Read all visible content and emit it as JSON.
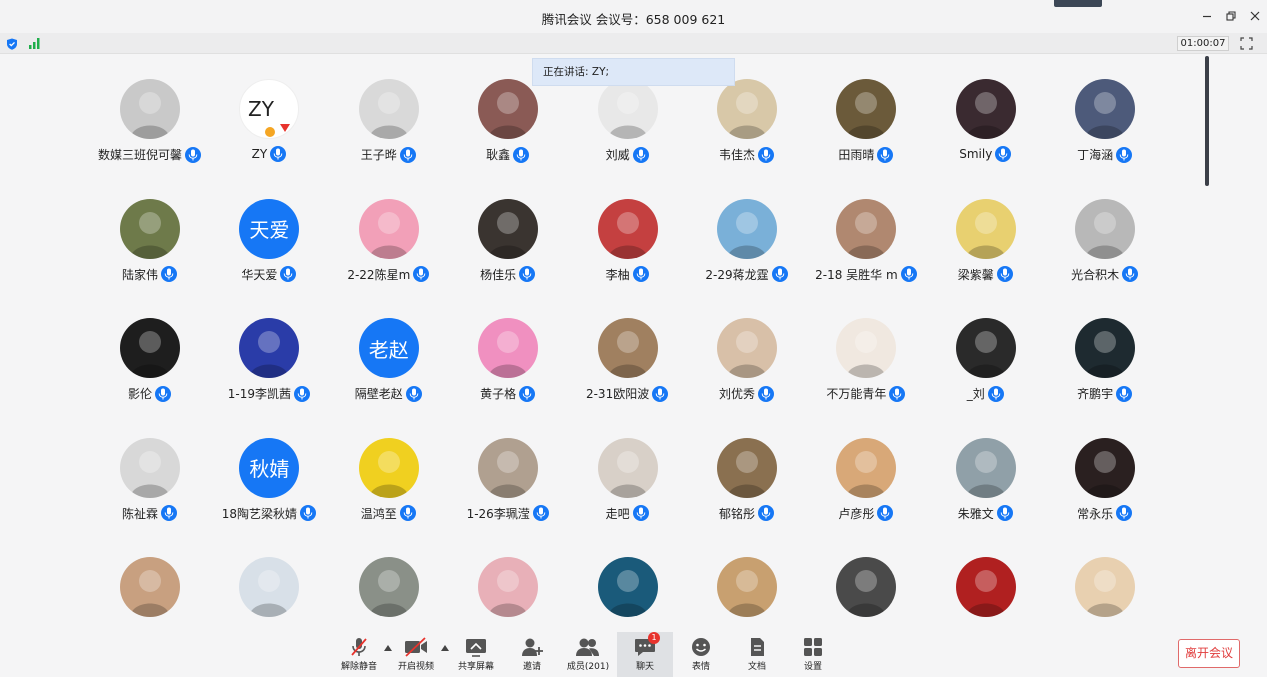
{
  "window": {
    "title": "腾讯会议 会议号：658 009 621"
  },
  "status": {
    "timer": "01:00:07",
    "speaking": "正在讲话: ZY;"
  },
  "participants": [
    {
      "name": "数媒三班倪可馨",
      "avatar": "photo",
      "color": "#c9c9c9"
    },
    {
      "name": "ZY",
      "avatar": "logo",
      "color": "#ffffff"
    },
    {
      "name": "王子晔",
      "avatar": "photo",
      "color": "#d9d9d9"
    },
    {
      "name": "耿鑫",
      "avatar": "photo",
      "color": "#8a5a55"
    },
    {
      "name": "刘威",
      "avatar": "photo",
      "color": "#e8e8e8"
    },
    {
      "name": "韦佳杰",
      "avatar": "photo",
      "color": "#d8c8a8"
    },
    {
      "name": "田雨晴",
      "avatar": "photo",
      "color": "#6b5a3a"
    },
    {
      "name": "Smily",
      "avatar": "photo",
      "color": "#3a2a30"
    },
    {
      "name": "丁海涵",
      "avatar": "photo",
      "color": "#4d5a7a"
    },
    {
      "name": "陆家伟",
      "avatar": "photo",
      "color": "#6e7a4a"
    },
    {
      "name": "华天爱",
      "avatar": "text",
      "text": "天爱",
      "color": "#1677f5"
    },
    {
      "name": "2-22陈星m",
      "avatar": "photo",
      "color": "#f2a0b8"
    },
    {
      "name": "杨佳乐",
      "avatar": "photo",
      "color": "#3a3430"
    },
    {
      "name": "李柚",
      "avatar": "photo",
      "color": "#c44040"
    },
    {
      "name": "2-29蒋龙霆",
      "avatar": "photo",
      "color": "#7ab0d8"
    },
    {
      "name": "2-18 吴胜华 m",
      "avatar": "photo",
      "color": "#b08870"
    },
    {
      "name": "梁紫馨",
      "avatar": "photo",
      "color": "#e8d070"
    },
    {
      "name": "光合积木",
      "avatar": "photo",
      "color": "#b8b8b8"
    },
    {
      "name": "影伦",
      "avatar": "photo",
      "color": "#1e1e1e"
    },
    {
      "name": "1-19李凯茜",
      "avatar": "photo",
      "color": "#2a3ca8"
    },
    {
      "name": "隔壁老赵",
      "avatar": "text",
      "text": "老赵",
      "color": "#1677f5"
    },
    {
      "name": "黄子格",
      "avatar": "photo",
      "color": "#f090c0"
    },
    {
      "name": "2-31欧阳波",
      "avatar": "photo",
      "color": "#a08060"
    },
    {
      "name": "刘优秀",
      "avatar": "photo",
      "color": "#d8c0a8"
    },
    {
      "name": "不万能青年",
      "avatar": "photo",
      "color": "#f0e8e0"
    },
    {
      "name": "_刘",
      "avatar": "photo",
      "color": "#2a2a2a"
    },
    {
      "name": "齐鹏宇",
      "avatar": "photo",
      "color": "#1e2a30"
    },
    {
      "name": "陈祉霖",
      "avatar": "photo",
      "color": "#d8d8d8"
    },
    {
      "name": "18陶艺梁秋婧",
      "avatar": "text",
      "text": "秋婧",
      "color": "#1677f5"
    },
    {
      "name": "温鸿至",
      "avatar": "photo",
      "color": "#f0d020"
    },
    {
      "name": "1-26李珮滢",
      "avatar": "photo",
      "color": "#b0a090"
    },
    {
      "name": "走吧",
      "avatar": "photo",
      "color": "#d8d0c8"
    },
    {
      "name": "郁铭彤",
      "avatar": "photo",
      "color": "#8a7050"
    },
    {
      "name": "卢彦彤",
      "avatar": "photo",
      "color": "#d8a878"
    },
    {
      "name": "朱雅文",
      "avatar": "photo",
      "color": "#90a0a8"
    },
    {
      "name": "常永乐",
      "avatar": "photo",
      "color": "#2a2020"
    },
    {
      "name": "",
      "avatar": "photo",
      "color": "#c8a080"
    },
    {
      "name": "",
      "avatar": "photo",
      "color": "#d8e0e8"
    },
    {
      "name": "",
      "avatar": "photo",
      "color": "#8a9088"
    },
    {
      "name": "",
      "avatar": "photo",
      "color": "#e8b0b8"
    },
    {
      "name": "",
      "avatar": "photo",
      "color": "#1a5a7a"
    },
    {
      "name": "",
      "avatar": "photo",
      "color": "#c8a070"
    },
    {
      "name": "",
      "avatar": "photo",
      "color": "#4a4a4a"
    },
    {
      "name": "",
      "avatar": "photo",
      "color": "#b02020"
    },
    {
      "name": "",
      "avatar": "photo",
      "color": "#e8d0b0"
    }
  ],
  "toolbar": {
    "unmute": "解除静音",
    "start_video": "开启视频",
    "share_screen": "共享屏幕",
    "invite": "邀请",
    "members": "成员(201)",
    "chat": "聊天",
    "chat_badge": "1",
    "emoji": "表情",
    "docs": "文档",
    "settings": "设置",
    "leave": "离开会议"
  },
  "icons": {
    "minimize": "minimize-icon",
    "restore": "restore-icon",
    "close": "close-icon",
    "fullscreen": "fullscreen-icon",
    "mic": "mic-icon"
  },
  "colors": {
    "accent": "#1677f5",
    "danger": "#e8332d",
    "leave": "#e03c3c"
  }
}
